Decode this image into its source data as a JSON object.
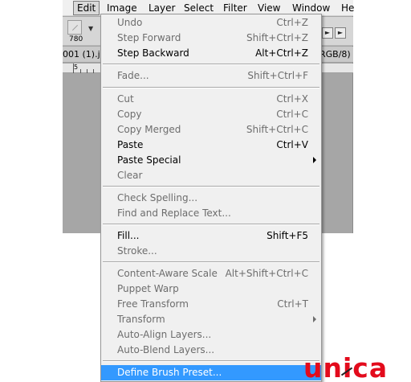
{
  "menubar": {
    "items": [
      "Edit",
      "Image",
      "Layer",
      "Select",
      "Filter",
      "View",
      "Window",
      "He"
    ]
  },
  "options_bar": {
    "brush_size": "780",
    "btn_a": "►",
    "btn_b": "►"
  },
  "document": {
    "tab_left": "001 (1).jp",
    "tab_right": "RGB/8)",
    "ruler_label": "5"
  },
  "edit_menu": {
    "items": [
      {
        "label": "Undo",
        "shortcut": "Ctrl+Z",
        "enabled": false
      },
      {
        "label": "Step Forward",
        "shortcut": "Shift+Ctrl+Z",
        "enabled": false
      },
      {
        "label": "Step Backward",
        "shortcut": "Alt+Ctrl+Z",
        "enabled": true
      },
      {
        "label": "Fade...",
        "shortcut": "Shift+Ctrl+F",
        "enabled": false
      },
      {
        "label": "Cut",
        "shortcut": "Ctrl+X",
        "enabled": false
      },
      {
        "label": "Copy",
        "shortcut": "Ctrl+C",
        "enabled": false
      },
      {
        "label": "Copy Merged",
        "shortcut": "Shift+Ctrl+C",
        "enabled": false
      },
      {
        "label": "Paste",
        "shortcut": "Ctrl+V",
        "enabled": true
      },
      {
        "label": "Paste Special",
        "shortcut": "",
        "enabled": true,
        "submenu": true
      },
      {
        "label": "Clear",
        "shortcut": "",
        "enabled": false
      },
      {
        "label": "Check Spelling...",
        "shortcut": "",
        "enabled": false
      },
      {
        "label": "Find and Replace Text...",
        "shortcut": "",
        "enabled": false
      },
      {
        "label": "Fill...",
        "shortcut": "Shift+F5",
        "enabled": true
      },
      {
        "label": "Stroke...",
        "shortcut": "",
        "enabled": false
      },
      {
        "label": "Content-Aware Scale",
        "shortcut": "Alt+Shift+Ctrl+C",
        "enabled": false
      },
      {
        "label": "Puppet Warp",
        "shortcut": "",
        "enabled": false
      },
      {
        "label": "Free Transform",
        "shortcut": "Ctrl+T",
        "enabled": false
      },
      {
        "label": "Transform",
        "shortcut": "",
        "enabled": false,
        "submenu": true
      },
      {
        "label": "Auto-Align Layers...",
        "shortcut": "",
        "enabled": false
      },
      {
        "label": "Auto-Blend Layers...",
        "shortcut": "",
        "enabled": false
      },
      {
        "label": "Define Brush Preset...",
        "shortcut": "",
        "enabled": true,
        "highlighted": true
      }
    ]
  },
  "watermark": {
    "logo_text": "unica"
  },
  "colors": {
    "highlight": "#3399ff",
    "logo": "#e30b1c"
  }
}
